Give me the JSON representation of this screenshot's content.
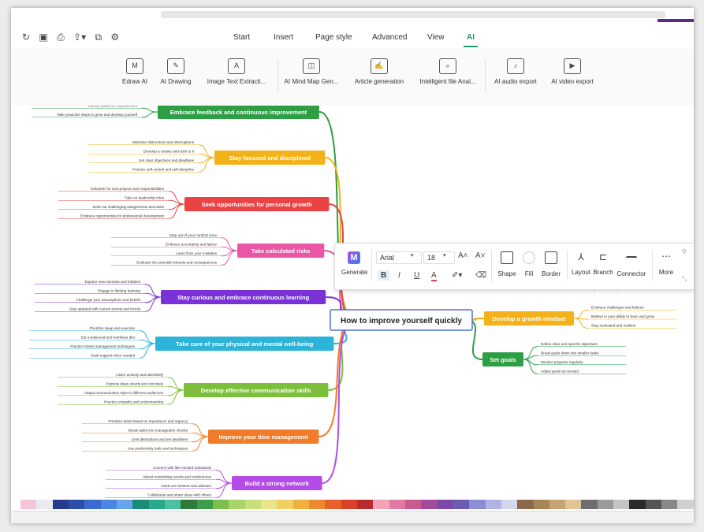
{
  "ribbon_tabs": [
    "Start",
    "Insert",
    "Page style",
    "Advanced",
    "View",
    "AI"
  ],
  "active_tab": "AI",
  "ai_tools": [
    {
      "label": "Edraw AI",
      "icon": "edraw-ai-icon"
    },
    {
      "label": "AI Drawing",
      "icon": "ai-drawing-icon"
    },
    {
      "label": "Image Text Extracti...",
      "icon": "image-text-icon"
    },
    {
      "label": "AI Mind Map Gen...",
      "icon": "mind-map-gen-icon"
    },
    {
      "label": "Article generation",
      "icon": "article-icon"
    },
    {
      "label": "Intelligent file Anal...",
      "icon": "file-analysis-icon"
    },
    {
      "label": "AI audio export",
      "icon": "audio-export-icon"
    },
    {
      "label": "AI video export",
      "icon": "video-export-icon"
    }
  ],
  "central_topic": "How to improve yourself quickly",
  "branches": [
    {
      "title": "Embrace feedback and continuous improvement",
      "color": "#2e9e45",
      "items": [
        "Identify areas for improvement",
        "Take proactive steps to grow and develop yourself"
      ]
    },
    {
      "title": "Stay focused and disciplined",
      "color": "#f3b21a",
      "items": [
        "Minimize distractions and interruptions",
        "Develop a routine and stick to it",
        "Set clear objectives and deadlines",
        "Practice self-control and self-discipline"
      ]
    },
    {
      "title": "Seek opportunities for personal growth",
      "color": "#e94343",
      "items": [
        "Volunteer for new projects and responsibilities",
        "Take on leadership roles",
        "Seek out challenging assignments and tasks",
        "Embrace opportunities for professional development"
      ]
    },
    {
      "title": "Take calculated risks",
      "color": "#e956a6",
      "items": [
        "Step out of your comfort zone",
        "Embrace uncertainty and failure",
        "Learn from your mistakes",
        "Evaluate the potential rewards and consequences"
      ]
    },
    {
      "title": "Stay curious and embrace continuous learning",
      "color": "#7a32d6",
      "items": [
        "Explore new interests and hobbies",
        "Engage in lifelong learning",
        "Challenge your assumptions and beliefs",
        "Stay updated with current events and trends"
      ]
    },
    {
      "title": "Take care of your physical and mental well-being",
      "color": "#2bb3d8",
      "items": [
        "Prioritize sleep and exercise",
        "Eat a balanced and nutritious diet",
        "Practice stress management techniques",
        "Seek support when needed"
      ]
    },
    {
      "title": "Develop effective communication skills",
      "color": "#7cbf3a",
      "items": [
        "Listen actively and attentively",
        "Express ideas clearly and concisely",
        "Adapt communication style to different audiences",
        "Practice empathy and understanding"
      ]
    },
    {
      "title": "Improve your time management",
      "color": "#f07c2a",
      "items": [
        "Prioritize tasks based on importance and urgency",
        "Break tasks into manageable chunks",
        "Limit distractions and set deadlines",
        "Use productivity tools and techniques"
      ]
    },
    {
      "title": "Build a strong network",
      "color": "#b54be6",
      "items": [
        "Connect with like-minded individuals",
        "Attend networking events and conferences",
        "Seek out mentors and advisors",
        "Collaborate and share ideas with others"
      ]
    }
  ],
  "right_branches": [
    {
      "title": "Develop a growth mindset",
      "color": "#f3b21a",
      "items": [
        "Embrace challenges and failures",
        "Believe in your ability to learn and grow",
        "Stay motivated and resilient"
      ]
    },
    {
      "title": "Set goals",
      "color": "#2e9e45",
      "items": [
        "Define clear and specific objectives",
        "Break goals down into smaller tasks",
        "Monitor progress regularly",
        "Adjust goals as needed"
      ]
    }
  ],
  "partial_item": "Identify areas for improvement",
  "floating_toolbar": {
    "generate": "Generate",
    "font": "Arial",
    "size": "18",
    "grow": "A˄",
    "shrink": "A˅",
    "bold": "B",
    "italic": "I",
    "underline": "U",
    "font_color": "A",
    "buttons": [
      "Shape",
      "Fill",
      "Border",
      "Layout",
      "Branch",
      "Connector",
      "More"
    ]
  },
  "palette": [
    "#f4c6d8",
    "#e9e9ef",
    "#263a8e",
    "#2d4ea8",
    "#3b6ad0",
    "#4b86e0",
    "#6aa4ea",
    "#1a8a7a",
    "#2aa88c",
    "#4cc0a0",
    "#2d7a3a",
    "#3e9b4c",
    "#7bc04e",
    "#a8d46c",
    "#c7e07a",
    "#e9e38a",
    "#f0d060",
    "#f0b040",
    "#ec8a30",
    "#e6602c",
    "#d8402a",
    "#b82c2c",
    "#f4a2b8",
    "#e07aa0",
    "#c85a90",
    "#a24a9c",
    "#7d49a8",
    "#6a5bb4",
    "#8a8ed0",
    "#b0b4e0",
    "#d4d6ec",
    "#8a6a4a",
    "#a8845a",
    "#c8a474",
    "#e0c498",
    "#6e6e6e",
    "#9a9a9a",
    "#c4c4c4",
    "#2a2a2a",
    "#545454",
    "#888888",
    "#d0d0d0"
  ]
}
